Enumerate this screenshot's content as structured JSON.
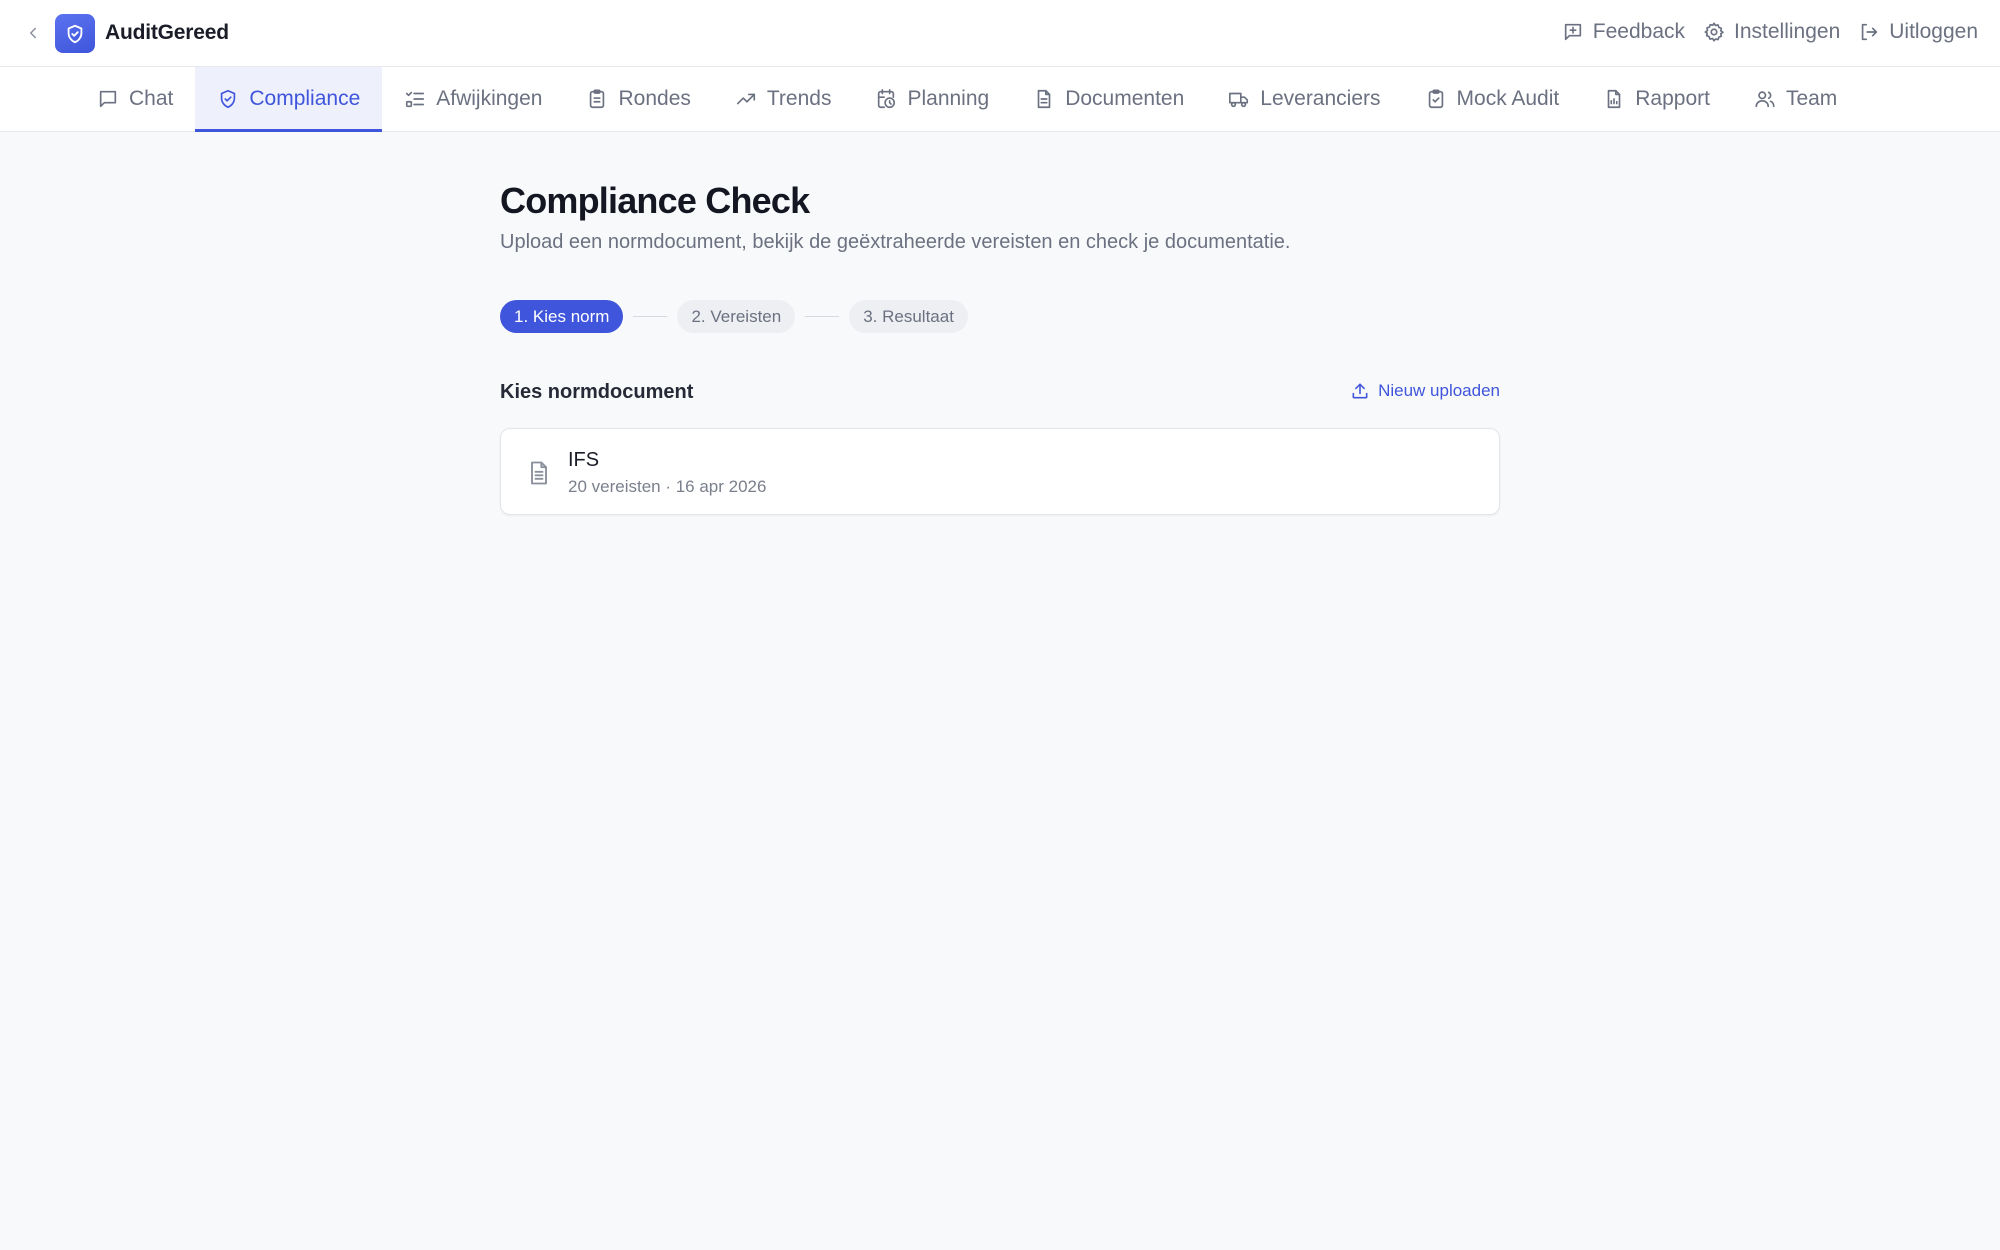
{
  "app": {
    "title": "AuditGereed"
  },
  "header": {
    "actions": [
      {
        "label": "Feedback",
        "icon": "feedback-icon"
      },
      {
        "label": "Instellingen",
        "icon": "gear-icon"
      },
      {
        "label": "Uitloggen",
        "icon": "logout-icon"
      }
    ]
  },
  "nav": {
    "tabs": [
      {
        "label": "Chat",
        "icon": "chat-icon"
      },
      {
        "label": "Compliance",
        "icon": "shield-check-icon",
        "active": true
      },
      {
        "label": "Afwijkingen",
        "icon": "checklist-icon"
      },
      {
        "label": "Rondes",
        "icon": "clipboard-icon"
      },
      {
        "label": "Trends",
        "icon": "trending-up-icon"
      },
      {
        "label": "Planning",
        "icon": "calendar-clock-icon"
      },
      {
        "label": "Documenten",
        "icon": "document-icon"
      },
      {
        "label": "Leveranciers",
        "icon": "truck-icon"
      },
      {
        "label": "Mock Audit",
        "icon": "clipboard-check-icon"
      },
      {
        "label": "Rapport",
        "icon": "report-icon"
      },
      {
        "label": "Team",
        "icon": "users-icon"
      }
    ]
  },
  "page": {
    "title": "Compliance Check",
    "subtitle": "Upload een normdocument, bekijk de geëxtraheerde vereisten en check je documentatie.",
    "steps": [
      "1. Kies norm",
      "2. Vereisten",
      "3. Resultaat"
    ],
    "active_step": 1,
    "section_title": "Kies normdocument",
    "upload_label": "Nieuw uploaden",
    "documents": [
      {
        "name": "IFS",
        "meta": "20 vereisten · 16 apr 2026"
      }
    ]
  },
  "colors": {
    "accent": "#3f55db",
    "background": "#f8f9fb",
    "muted_text": "#6b7180"
  }
}
